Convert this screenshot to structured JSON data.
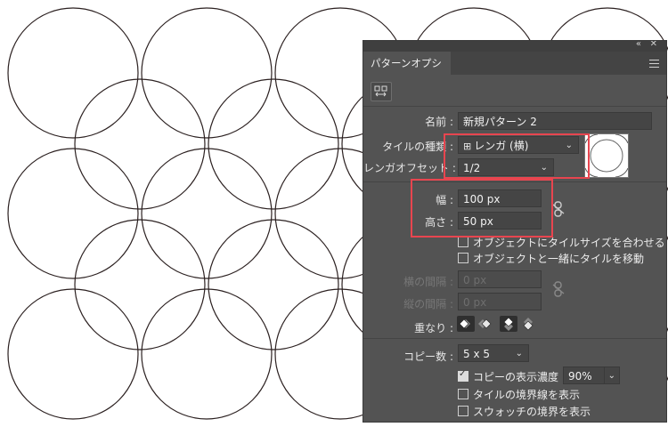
{
  "panel": {
    "tab_label": "パターンオプション",
    "collapse_glyph": "«",
    "close_glyph": "✕"
  },
  "fields": {
    "name_label": "名前 :",
    "name_value": "新規パターン 2",
    "tile_type_label": "タイルの種類 :",
    "tile_type_value": "レンガ (横)",
    "brick_offset_label": "レンガオフセット :",
    "brick_offset_value": "1/2",
    "width_label": "幅 :",
    "width_value": "100 px",
    "height_label": "高さ :",
    "height_value": "50 px",
    "fit_to_art": "オブジェクトにタイルサイズを合わせる",
    "move_with_art": "オブジェクトと一緒にタイルを移動",
    "h_spacing_label": "横の間隔 :",
    "h_spacing_value": "0 px",
    "v_spacing_label": "縦の間隔 :",
    "v_spacing_value": "0 px",
    "overlap_label": "重なり :",
    "copies_label": "コピー数 :",
    "copies_value": "5 x 5",
    "dim_copies": "コピーの表示濃度 :",
    "dim_value": "90%",
    "show_tile_edge": "タイルの境界線を表示",
    "show_swatch_bounds": "スウォッチの境界を表示"
  },
  "checks": {
    "fit_to_art": false,
    "move_with_art": false,
    "dim_copies": true,
    "show_tile_edge": false,
    "show_swatch_bounds": false
  },
  "colors": {
    "panel_bg": "#535353",
    "highlight": "#e8454f",
    "circle_stroke": "#2b2020"
  }
}
